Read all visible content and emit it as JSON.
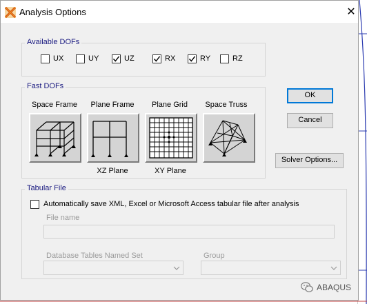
{
  "window": {
    "title": "Analysis Options",
    "close_glyph": "✕"
  },
  "available_dofs": {
    "label": "Available DOFs",
    "items": [
      {
        "label": "UX",
        "checked": false
      },
      {
        "label": "UY",
        "checked": false
      },
      {
        "label": "UZ",
        "checked": true
      },
      {
        "label": "RX",
        "checked": true
      },
      {
        "label": "RY",
        "checked": true
      },
      {
        "label": "RZ",
        "checked": false
      }
    ]
  },
  "fast_dofs": {
    "label": "Fast DOFs",
    "options": [
      {
        "title": "Space Frame",
        "sublabel": "",
        "icon": "space-frame-icon"
      },
      {
        "title": "Plane Frame",
        "sublabel": "XZ Plane",
        "icon": "plane-frame-icon"
      },
      {
        "title": "Plane Grid",
        "sublabel": "XY Plane",
        "icon": "plane-grid-icon"
      },
      {
        "title": "Space Truss",
        "sublabel": "",
        "icon": "space-truss-icon"
      }
    ]
  },
  "buttons": {
    "ok": "OK",
    "cancel": "Cancel",
    "solver_options": "Solver Options..."
  },
  "tabular_file": {
    "label": "Tabular File",
    "auto_save_label": "Automatically save XML, Excel or Microsoft Access tabular file after analysis",
    "auto_save_checked": false,
    "file_name_label": "File name",
    "file_name_value": "",
    "named_set_label": "Database Tables Named Set",
    "named_set_value": "",
    "group_label": "Group",
    "group_value": ""
  },
  "watermark": {
    "text": "ABAQUS"
  },
  "colors": {
    "accent": "#0078d7",
    "group_label": "#1a1a80",
    "background_line": "#2b3bb0"
  }
}
